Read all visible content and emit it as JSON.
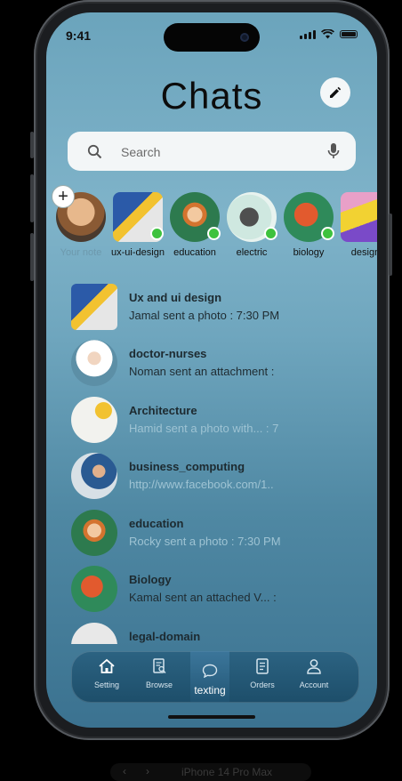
{
  "status": {
    "time": "9:41"
  },
  "header": {
    "title": "Chats"
  },
  "search": {
    "placeholder": "Search"
  },
  "stories": [
    {
      "label": "Your note",
      "online": false
    },
    {
      "label": "ux-ui-design",
      "online": true
    },
    {
      "label": "education",
      "online": true
    },
    {
      "label": "electric",
      "online": true
    },
    {
      "label": "biology",
      "online": true
    },
    {
      "label": "design",
      "online": false
    }
  ],
  "chats": [
    {
      "name": "Ux and ui design",
      "message": "Jamal sent a photo  : 7:30 PM",
      "faint": false
    },
    {
      "name": "doctor-nurses",
      "message": "Noman sent an attachment  :",
      "faint": false
    },
    {
      "name": "Architecture",
      "message": "Hamid sent a photo with...  : 7",
      "faint": true
    },
    {
      "name": "business_computing",
      "message": "http://www.facebook.com/1..",
      "faint": true
    },
    {
      "name": "education",
      "message": "Rocky sent a photo  : 7:30 PM",
      "faint": true
    },
    {
      "name": "Biology",
      "message": "Kamal sent an attached V...  :",
      "faint": false
    },
    {
      "name": "legal-domain",
      "message": "",
      "faint": false
    }
  ],
  "tabbar": {
    "setting": "Setting",
    "browse": "Browse",
    "texting": "texting",
    "orders": "Orders",
    "account": "Account"
  },
  "device_caption": "iPhone 14 Pro Max",
  "colors": {
    "online": "#3ec23e",
    "tabbar": "#1d4e6a",
    "screen_top": "#6ba4bc"
  }
}
